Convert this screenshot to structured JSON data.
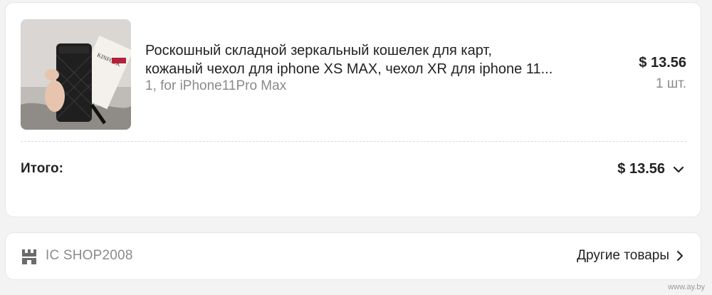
{
  "order": {
    "product": {
      "title_line1": "Роскошный складной зеркальный кошелек для карт,",
      "title_line2": "кожаный чехол для iphone XS MAX, чехол XR для iphone 11...",
      "variant": "1, for iPhone11Pro Max",
      "price": "$ 13.56",
      "quantity": "1 шт.",
      "image_brand_text": "KINFOLK"
    },
    "total": {
      "label": "Итого:",
      "value": "$ 13.56",
      "toggle_icon": "chevron-down-icon"
    }
  },
  "shop": {
    "icon": "store-icon",
    "name": "IC SHOP2008",
    "more_label": "Другие товары",
    "more_icon": "chevron-right-icon"
  },
  "watermark": "www.ay.by",
  "colors": {
    "page_bg": "#f3f3f3",
    "card_bg": "#ffffff",
    "text_primary": "#222222",
    "text_secondary": "#8a8a8a",
    "border": "#e6e6e6"
  }
}
